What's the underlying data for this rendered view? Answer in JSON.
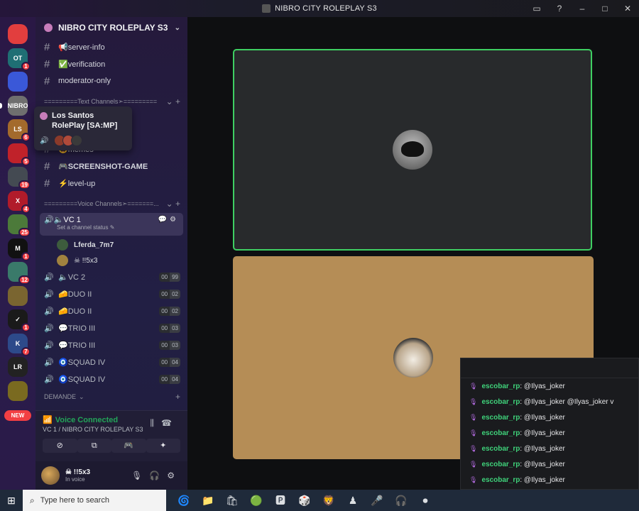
{
  "window": {
    "title": "NIBRO CITY ROLEPLAY S3",
    "controls": [
      "▭",
      "?",
      "–",
      "□",
      "✕"
    ]
  },
  "rail": {
    "servers": [
      {
        "name": "discord-home",
        "label": "",
        "badge": "",
        "color": "#e23e3e"
      },
      {
        "name": "server-1",
        "label": "OT",
        "badge": "1",
        "color": "#1f6f74"
      },
      {
        "name": "server-2",
        "label": "",
        "badge": "",
        "color": "#3a58d8"
      },
      {
        "name": "server-3",
        "label": "NIBRO",
        "badge": "",
        "color": "#6f6f6f"
      },
      {
        "name": "server-4",
        "label": "LS",
        "badge": "6",
        "color": "#a36a2c"
      },
      {
        "name": "server-5",
        "label": "",
        "badge": "5",
        "color": "#c0222a"
      },
      {
        "name": "server-6",
        "label": "",
        "badge": "19",
        "color": "#444a52"
      },
      {
        "name": "server-7",
        "label": "X",
        "badge": "4",
        "color": "#b11b2a"
      },
      {
        "name": "server-8",
        "label": "",
        "badge": "25",
        "color": "#4c7a3a"
      },
      {
        "name": "server-9",
        "label": "M",
        "badge": "1",
        "color": "#111111"
      },
      {
        "name": "server-10",
        "label": "",
        "badge": "12",
        "color": "#3a7a6a"
      },
      {
        "name": "server-11",
        "label": "",
        "badge": "",
        "color": "#7a6530"
      },
      {
        "name": "server-12",
        "label": "✓",
        "badge": "1",
        "color": "#1a1a1a"
      },
      {
        "name": "server-13",
        "label": "K",
        "badge": "7",
        "color": "#2d4a8a"
      },
      {
        "name": "server-14",
        "label": "LR",
        "badge": "",
        "color": "#222222"
      },
      {
        "name": "server-15",
        "label": "",
        "badge": "",
        "color": "#7a6a20"
      }
    ],
    "new_label": "NEW"
  },
  "sidebar": {
    "server_name": "NIBRO CITY ROLEPLAY S3",
    "top_channels": [
      {
        "label": "📢server-info"
      },
      {
        "label": "✅verification"
      },
      {
        "label": "moderator-only"
      }
    ],
    "text_category": "=========Text Channels➣=========",
    "text_channels": [
      {
        "label": "😄memes"
      },
      {
        "label": "🎮SCREENSHOT-GAME"
      },
      {
        "label": "⚡level-up"
      }
    ],
    "voice_category": "=========Voice Channels➣=======...",
    "active_voice": {
      "label": "🔈VC 1",
      "status": "Set a channel status ✎"
    },
    "members": [
      {
        "name": "Lferda_7m7",
        "color": "#3d5c3d"
      },
      {
        "name": "☠ !!5x3",
        "color": "#a0823f"
      }
    ],
    "voice_channels": [
      {
        "label": "🔈VC 2",
        "a": "00",
        "b": "99"
      },
      {
        "label": "🧀DUO II",
        "a": "00",
        "b": "02"
      },
      {
        "label": "🧀DUO II",
        "a": "00",
        "b": "02"
      },
      {
        "label": "💬TRIO III",
        "a": "00",
        "b": "03"
      },
      {
        "label": "💬TRIO III",
        "a": "00",
        "b": "03"
      },
      {
        "label": "🧿SQUAD IV",
        "a": "00",
        "b": "04"
      },
      {
        "label": "🧿SQUAD IV",
        "a": "00",
        "b": "04"
      }
    ],
    "demande_category": "DEMANDE"
  },
  "popup": {
    "title": "Los Santos RolePlay [SA:MP]"
  },
  "voice_panel": {
    "status": "Voice Connected",
    "location": "VC 1 / NIBRO CITY ROLEPLAY S3"
  },
  "user": {
    "name": "☠ !!5x3",
    "status": "In voice"
  },
  "chat": {
    "messages": [
      {
        "user": "escobar_rp",
        "text": ": @Ilyas_joker"
      },
      {
        "user": "escobar_rp",
        "text": ": @Ilyas_joker @Ilyas_joker v"
      },
      {
        "user": "escobar_rp",
        "text": ": @Ilyas_joker"
      },
      {
        "user": "escobar_rp",
        "text": ": @Ilyas_joker"
      },
      {
        "user": "escobar_rp",
        "text": ": @Ilyas_joker"
      },
      {
        "user": "escobar_rp",
        "text": ": @Ilyas_joker"
      },
      {
        "user": "escobar_rp",
        "text": ": @Ilyas_joker"
      },
      {
        "user": "escobar_rp",
        "text": ": @Ilyas_joker"
      }
    ]
  },
  "taskbar": {
    "search_placeholder": "Type here to search"
  }
}
